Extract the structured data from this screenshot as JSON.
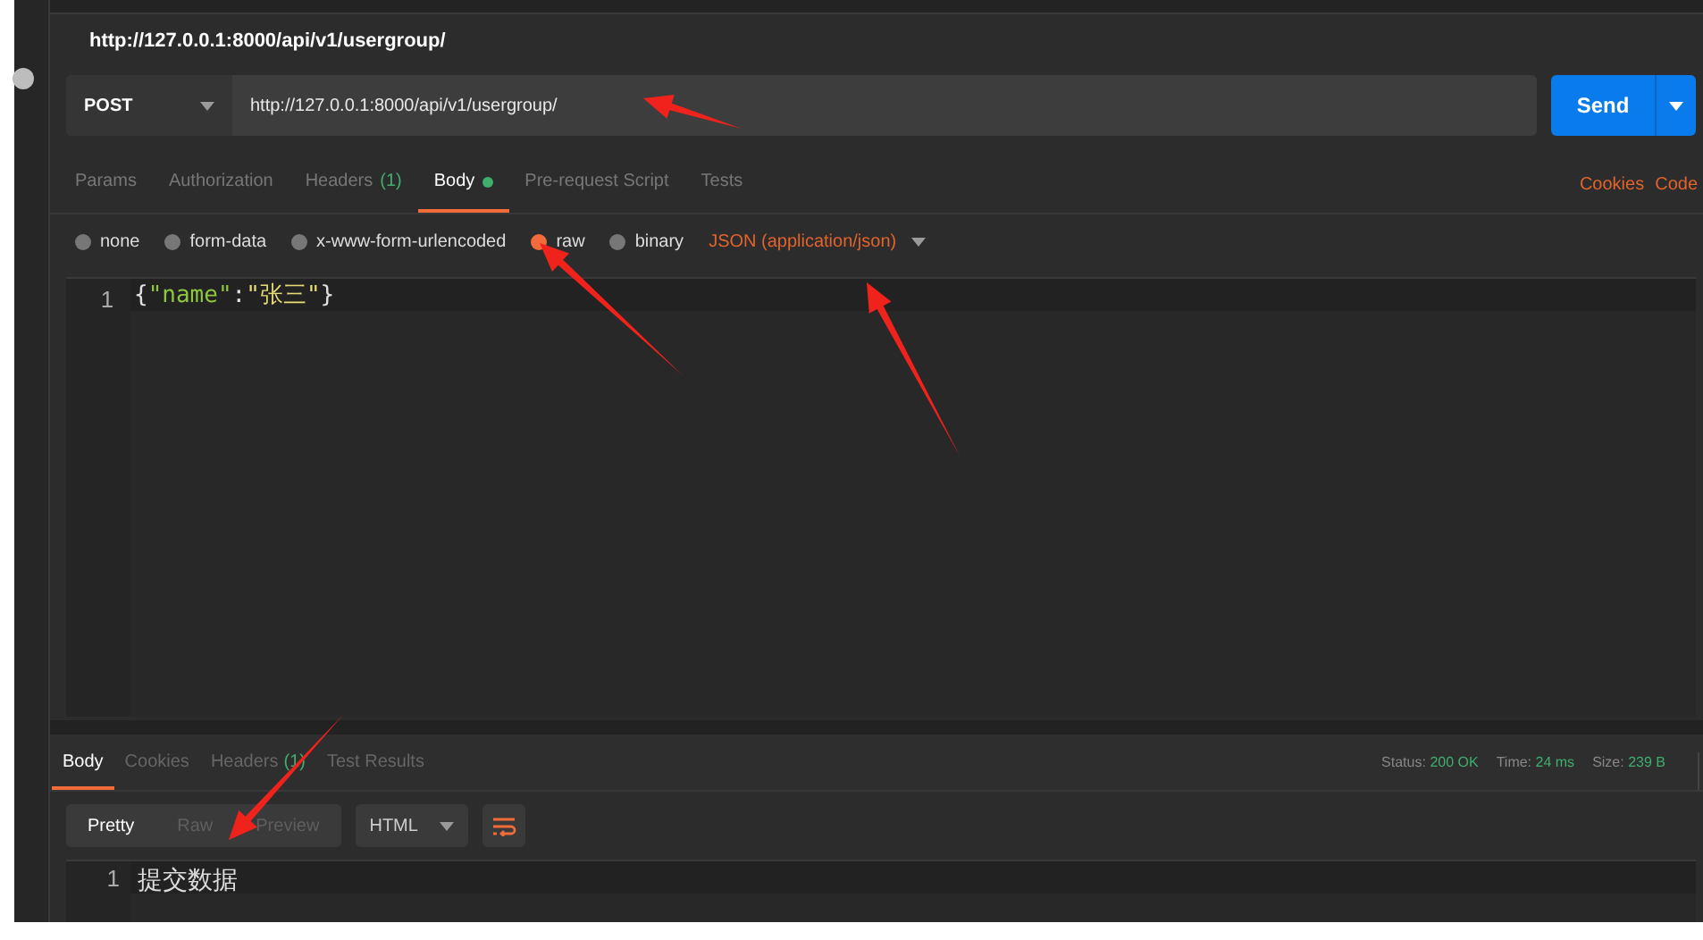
{
  "title": "http://127.0.0.1:8000/api/v1/usergroup/",
  "request": {
    "method": "POST",
    "url": "http://127.0.0.1:8000/api/v1/usergroup/",
    "send": "Send"
  },
  "request_tabs": [
    {
      "label": "Params",
      "selected": false
    },
    {
      "label": "Authorization",
      "selected": false
    },
    {
      "label": "Headers",
      "count": "(1)",
      "selected": false
    },
    {
      "label": "Body",
      "dot": true,
      "selected": true
    },
    {
      "label": "Pre-request Script",
      "selected": false
    },
    {
      "label": "Tests",
      "selected": false
    }
  ],
  "request_links": [
    "Cookies",
    "Code"
  ],
  "body_modes": [
    {
      "label": "none",
      "selected": false
    },
    {
      "label": "form-data",
      "selected": false
    },
    {
      "label": "x-www-form-urlencoded",
      "selected": false
    },
    {
      "label": "raw",
      "selected": true
    },
    {
      "label": "binary",
      "selected": false
    }
  ],
  "content_type": "JSON (application/json)",
  "editor": {
    "lines": [
      {
        "number": "1",
        "tokens": [
          {
            "kind": "punct",
            "text": "{"
          },
          {
            "kind": "key",
            "text": "\"name\""
          },
          {
            "kind": "punct",
            "text": ":"
          },
          {
            "kind": "string",
            "text": "\"张三\""
          },
          {
            "kind": "punct",
            "text": "}"
          }
        ]
      }
    ]
  },
  "response_tabs": [
    {
      "label": "Body",
      "selected": true
    },
    {
      "label": "Cookies",
      "selected": false
    },
    {
      "label": "Headers",
      "count": "(1)",
      "selected": false
    },
    {
      "label": "Test Results",
      "selected": false
    }
  ],
  "status": [
    {
      "label": "Status:",
      "value": "200 OK"
    },
    {
      "label": "Time:",
      "value": "24 ms"
    },
    {
      "label": "Size:",
      "value": "239 B"
    }
  ],
  "view_modes": [
    {
      "label": "Pretty",
      "selected": true
    },
    {
      "label": "Raw",
      "selected": false
    },
    {
      "label": "Preview",
      "selected": false
    }
  ],
  "format": "HTML",
  "response": {
    "lines": [
      {
        "number": "1",
        "text": "提交数据"
      }
    ]
  }
}
